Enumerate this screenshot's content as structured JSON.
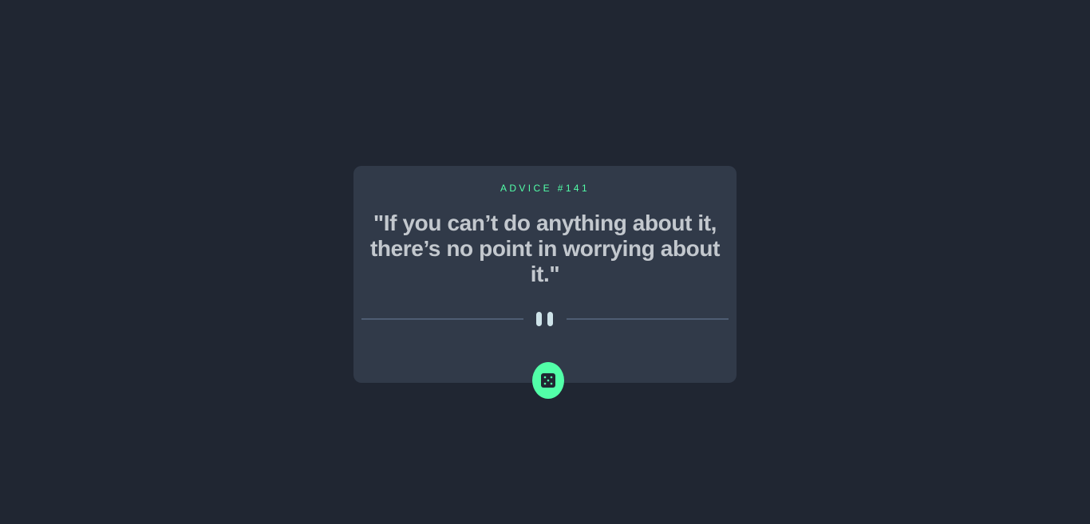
{
  "card": {
    "advice_label": "ADVICE #141",
    "quote": "\"If you can’t do anything about it, there’s no point in worrying about it.\""
  },
  "icons": {
    "divider_icon": "pause-icon",
    "button_icon": "dice-icon"
  },
  "colors": {
    "background": "#202632",
    "card": "#313a49",
    "accent": "#52ffa8",
    "quote_text": "#c3c8ce",
    "divider": "#4e5d73"
  }
}
